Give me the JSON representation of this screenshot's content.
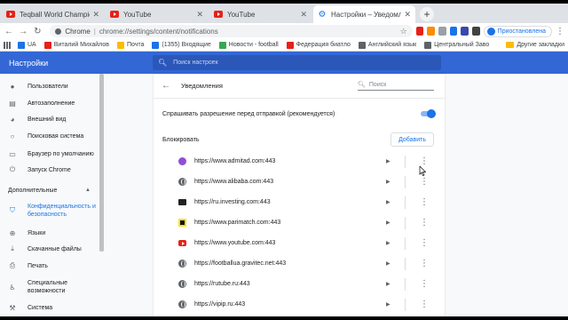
{
  "tabs": [
    {
      "title": "Teqball World Championships 2",
      "favicon": "youtube-icon"
    },
    {
      "title": "YouTube",
      "favicon": "youtube-icon"
    },
    {
      "title": "YouTube",
      "favicon": "youtube-icon"
    },
    {
      "title": "Настройки – Уведомления",
      "favicon": "gear-icon",
      "active": true
    }
  ],
  "toolbar": {
    "browser_label": "Chrome",
    "url": "chrome://settings/content/notifications",
    "paused_label": "Приостановлена"
  },
  "bookmarks": {
    "items": [
      {
        "label": "UA",
        "color": "#1a73e8"
      },
      {
        "label": "Виталий Михайлов",
        "color": "#e62117"
      },
      {
        "label": "Почта",
        "color": "#fbbc04"
      },
      {
        "label": "(1355) Входящие",
        "color": "#1a73e8"
      },
      {
        "label": "Новости - football",
        "color": "#34a853"
      },
      {
        "label": "Федерация биатло",
        "color": "#e62117"
      },
      {
        "label": "Английский язык",
        "color": "#5f6368"
      },
      {
        "label": "Центральный Заво",
        "color": "#5f6368"
      }
    ],
    "other": "Другие закладки"
  },
  "header": {
    "title": "Настройки",
    "search_placeholder": "Поиск настроек"
  },
  "sidebar": {
    "items": [
      {
        "label": "Пользователи",
        "icon": "person-icon"
      },
      {
        "label": "Автозаполнение",
        "icon": "autofill-icon"
      },
      {
        "label": "Внешний вид",
        "icon": "palette-icon"
      },
      {
        "label": "Поисковая система",
        "icon": "search-icon"
      },
      {
        "label": "Браузер по умолчанию",
        "icon": "browser-icon"
      },
      {
        "label": "Запуск Chrome",
        "icon": "power-icon"
      }
    ],
    "advanced_label": "Дополнительные",
    "advanced_items": [
      {
        "label": "Конфиденциальность и безопасность",
        "icon": "shield-icon",
        "active": true
      },
      {
        "label": "Языки",
        "icon": "globe-icon"
      },
      {
        "label": "Скачанные файлы",
        "icon": "download-icon"
      },
      {
        "label": "Печать",
        "icon": "print-icon"
      },
      {
        "label": "Специальные возможности",
        "icon": "accessibility-icon"
      },
      {
        "label": "Система",
        "icon": "wrench-icon"
      }
    ]
  },
  "page": {
    "title": "Уведомления",
    "search_placeholder": "Поиск",
    "ask_label": "Спрашивать разрешение перед отправкой (рекомендуется)",
    "ask_enabled": true,
    "block_label": "Блокировать",
    "add_button": "Добавить"
  },
  "sites": [
    {
      "url": "https://www.admitad.com:443",
      "icon": "admitad-icon"
    },
    {
      "url": "https://www.alibaba.com:443",
      "icon": "globe-icon"
    },
    {
      "url": "https://ru.investing.com:443",
      "icon": "investing-icon"
    },
    {
      "url": "https://www.parimatch.com:443",
      "icon": "parimatch-icon"
    },
    {
      "url": "https://www.youtube.com:443",
      "icon": "youtube-icon"
    },
    {
      "url": "https://footballua.gravitec.net:443",
      "icon": "globe-icon"
    },
    {
      "url": "https://rutube.ru:443",
      "icon": "globe-icon"
    },
    {
      "url": "https://vipip.ru:443",
      "icon": "globe-icon"
    }
  ],
  "colors": {
    "header_blue": "#3367d6",
    "accent": "#1a73e8"
  }
}
